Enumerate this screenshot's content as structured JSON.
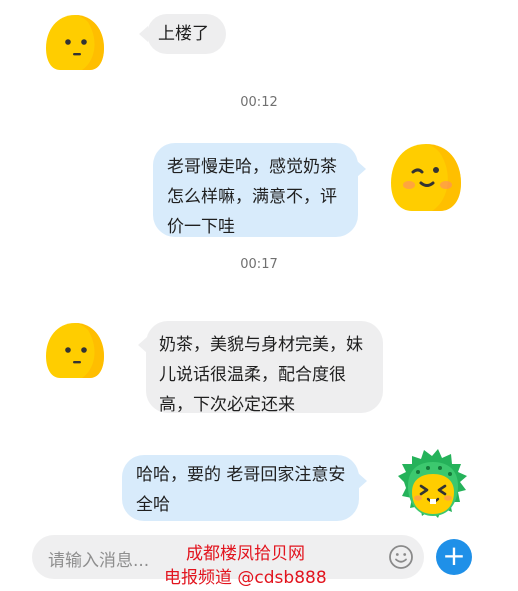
{
  "messages": [
    {
      "side": "left",
      "text": "上楼了"
    },
    {
      "side": "right",
      "text": "老哥慢走哈，感觉奶茶怎么样嘛，满意不，评价一下哇"
    },
    {
      "side": "left",
      "text": "奶茶，美貌与身材完美，妹儿说话很温柔，配合度很高，下次必定还来"
    },
    {
      "side": "right",
      "text": "哈哈，要的 老哥回家注意安全哈"
    }
  ],
  "timestamps": [
    "00:12",
    "00:17"
  ],
  "input": {
    "placeholder": "请输入消息..."
  },
  "icons": {
    "emoji": "smiley-icon",
    "send": "plus-icon"
  },
  "send_symbol": "+",
  "watermark": {
    "line1": "成都楼凤拾贝网",
    "line2": "电报频道 @cdsb888"
  },
  "colors": {
    "accent": "#1f90e8",
    "right_bubble": "#d8ebfb",
    "left_bubble": "#eeeeef",
    "watermark": "#e2141e"
  }
}
